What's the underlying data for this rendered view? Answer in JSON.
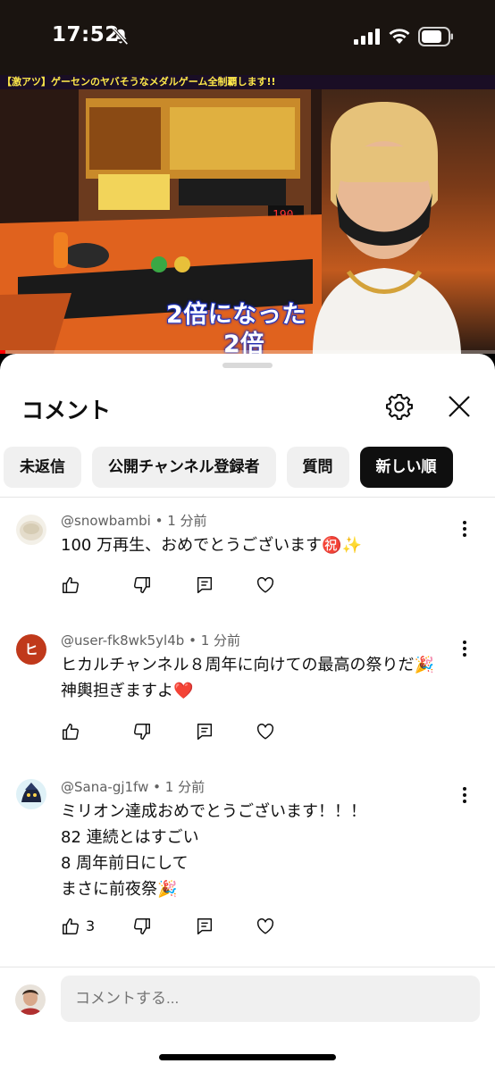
{
  "status_bar": {
    "time": "17:52"
  },
  "video": {
    "title_strip": "【激アツ】ゲーセンのヤバそうなメダルゲーム全制覇します!!",
    "caption_line1": "2倍になった",
    "caption_line2": "2倍",
    "progress": 0.01,
    "progress_color": "#ff0000"
  },
  "sheet": {
    "title": "コメント",
    "filter_chips": [
      {
        "label": "未返信",
        "selected": false
      },
      {
        "label": "公開チャンネル登録者",
        "selected": false
      },
      {
        "label": "質問",
        "selected": false
      },
      {
        "label": "新しい順",
        "selected": true
      }
    ]
  },
  "comments": [
    {
      "author": "@snowbambi",
      "time": "1 分前",
      "lines": [
        "100 万再生、おめでとうございます㊗️✨"
      ],
      "likes": ""
    },
    {
      "author": "@user-fk8wk5yl4b",
      "time": "1 分前",
      "avatar_letter": "ヒ",
      "avatar_color": "#c0391b",
      "lines": [
        "ヒカルチャンネル８周年に向けての最高の祭りだ🎉",
        "神輿担ぎますよ❤️"
      ],
      "likes": ""
    },
    {
      "author": "@Sana-gj1fw",
      "time": "1 分前",
      "lines": [
        "ミリオン達成おめでとうございます！！！",
        "82 連続とはすごい",
        "8 周年前日にして",
        "まさに前夜祭🎉"
      ],
      "likes": "3"
    }
  ],
  "composer": {
    "placeholder": "コメントする..."
  },
  "separator": "•"
}
